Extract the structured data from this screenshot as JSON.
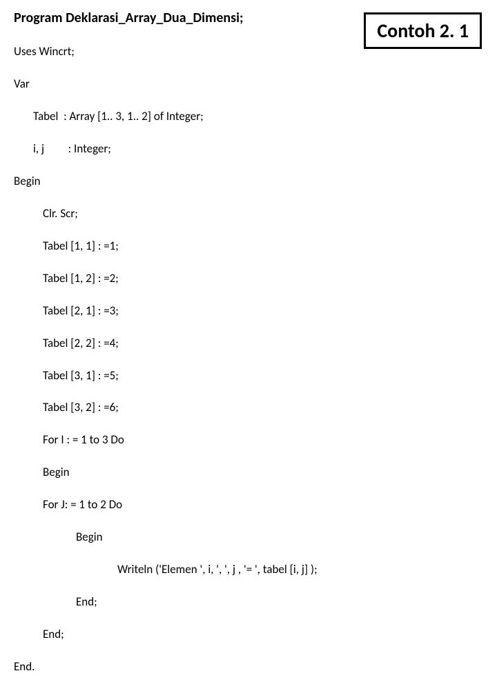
{
  "title": "Program Deklarasi_Array_Dua_Dimensi;",
  "callout": "Contoh 2. 1",
  "code": {
    "l1": "Uses Wincrt;",
    "l2": "Var",
    "l3": "Tabel  : Array [1.. 3, 1.. 2] of Integer;",
    "l4": "i, j         : Integer;",
    "l5": "Begin",
    "l6": "Clr. Scr;",
    "l7": "Tabel [1, 1] : =1;",
    "l8": "Tabel [1, 2] : =2;",
    "l9": "Tabel [2, 1] : =3;",
    "l10": "Tabel [2, 2] : =4;",
    "l11": "Tabel [3, 1] : =5;",
    "l12": "Tabel [3, 2] : =6;",
    "l13": "For I : = 1 to 3 Do",
    "l14": "Begin",
    "l15": "For J: = 1 to 2 Do",
    "l16": "Begin",
    "l17": "Writeln ('Elemen ', i, ', ', j , '= ', tabel [i, j] );",
    "l18": "End;",
    "l19": "End;",
    "l20": "End."
  }
}
